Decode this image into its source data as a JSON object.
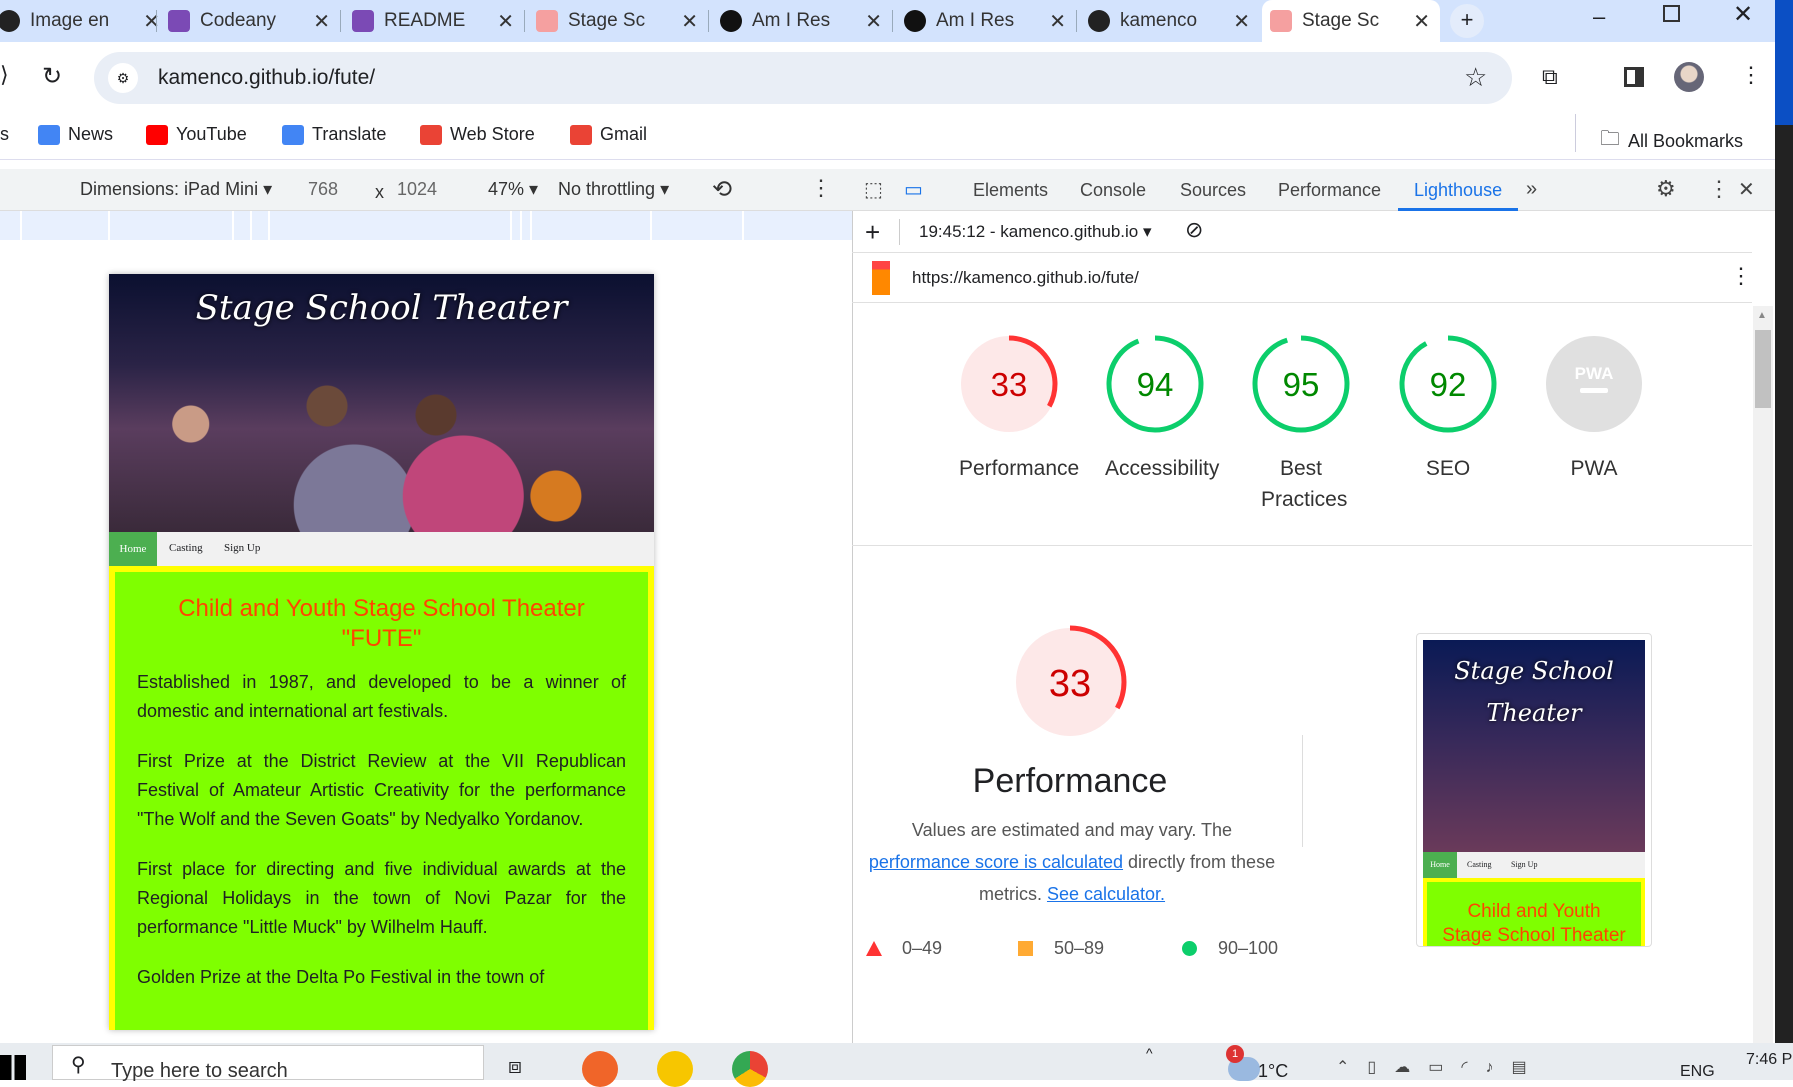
{
  "tabs": [
    {
      "label": "Image en",
      "color": "#222"
    },
    {
      "label": "Codeany",
      "color": "#7b4ab5"
    },
    {
      "label": "README",
      "color": "#7b4ab5"
    },
    {
      "label": "Stage Sc",
      "color": "#f5a0a0"
    },
    {
      "label": "Am I Res",
      "color": "#111"
    },
    {
      "label": "Am I Res",
      "color": "#111"
    },
    {
      "label": "kamenco",
      "color": "#222"
    },
    {
      "label": "Stage Sc",
      "color": "#f5a0a0"
    }
  ],
  "address": "kamenco.github.io/fute/",
  "bookmarks": [
    {
      "label": "News",
      "color": "#4285f4"
    },
    {
      "label": "YouTube",
      "color": "#ff0000"
    },
    {
      "label": "Translate",
      "color": "#4285f4"
    },
    {
      "label": "Web Store",
      "color": "#ea4335"
    },
    {
      "label": "Gmail",
      "color": "#ea4335"
    }
  ],
  "all_bookmarks": "All Bookmarks",
  "device": {
    "dimensions": "Dimensions: iPad Mini",
    "width": "768",
    "x": "x",
    "height": "1024",
    "zoom": "47%",
    "throttling": "No throttling"
  },
  "site": {
    "title": "Stage School Theater",
    "nav": [
      "Home",
      "Casting",
      "Sign Up"
    ],
    "heading": "Child and Youth Stage School Theater \"FUTE\"",
    "paragraphs": [
      "Established in 1987, and developed to be a winner of domestic and international art festivals.",
      "First Prize at the District Review at the VII Republican Festival of Amateur Artistic Creativity for the performance \"The Wolf and the Seven Goats\" by Nedyalko Yordanov.",
      "First place for directing and five individual awards at the Regional Holidays in the town of Novi Pazar for the performance \"Little Muck\" by Wilhelm Hauff.",
      "Golden Prize at the Delta Po Festival in the town of"
    ]
  },
  "devtools": {
    "tabs": [
      "Elements",
      "Console",
      "Sources",
      "Performance",
      "Lighthouse"
    ],
    "active": "Lighthouse",
    "report": "19:45:12 - kamenco.github.io",
    "url": "https://kamenco.github.io/fute/"
  },
  "scores": [
    {
      "label": "Performance",
      "score": 33,
      "color": "#ff3333",
      "bg": "#fde8e8",
      "text": "#c00"
    },
    {
      "label": "Accessibility",
      "score": 94,
      "color": "#0cce6b",
      "bg": "#fff",
      "text": "#080"
    },
    {
      "label": "Best Practices",
      "score": 95,
      "color": "#0cce6b",
      "bg": "#fff",
      "text": "#080"
    },
    {
      "label": "SEO",
      "score": 92,
      "color": "#0cce6b",
      "bg": "#fff",
      "text": "#080"
    },
    {
      "label": "PWA",
      "score": null,
      "badge": "PWA",
      "color": "#ccc",
      "bg": "#e0e0e0",
      "text": "#fff"
    }
  ],
  "perf": {
    "score": "33",
    "title": "Performance",
    "desc1": "Values are estimated and may vary. The ",
    "link1": "performance score is calculated",
    "desc2": " directly from these metrics. ",
    "link2": "See calculator.",
    "legend": [
      "0–49",
      "50–89",
      "90–100"
    ],
    "thumb_title": "Stage School Theater",
    "thumb_heading": "Child and Youth Stage School Theater \"FUTE\""
  },
  "taskbar": {
    "search": "Type here to search",
    "temp": "1°C",
    "lang": "ENG",
    "time": "7:46 P",
    "badge": "1"
  }
}
